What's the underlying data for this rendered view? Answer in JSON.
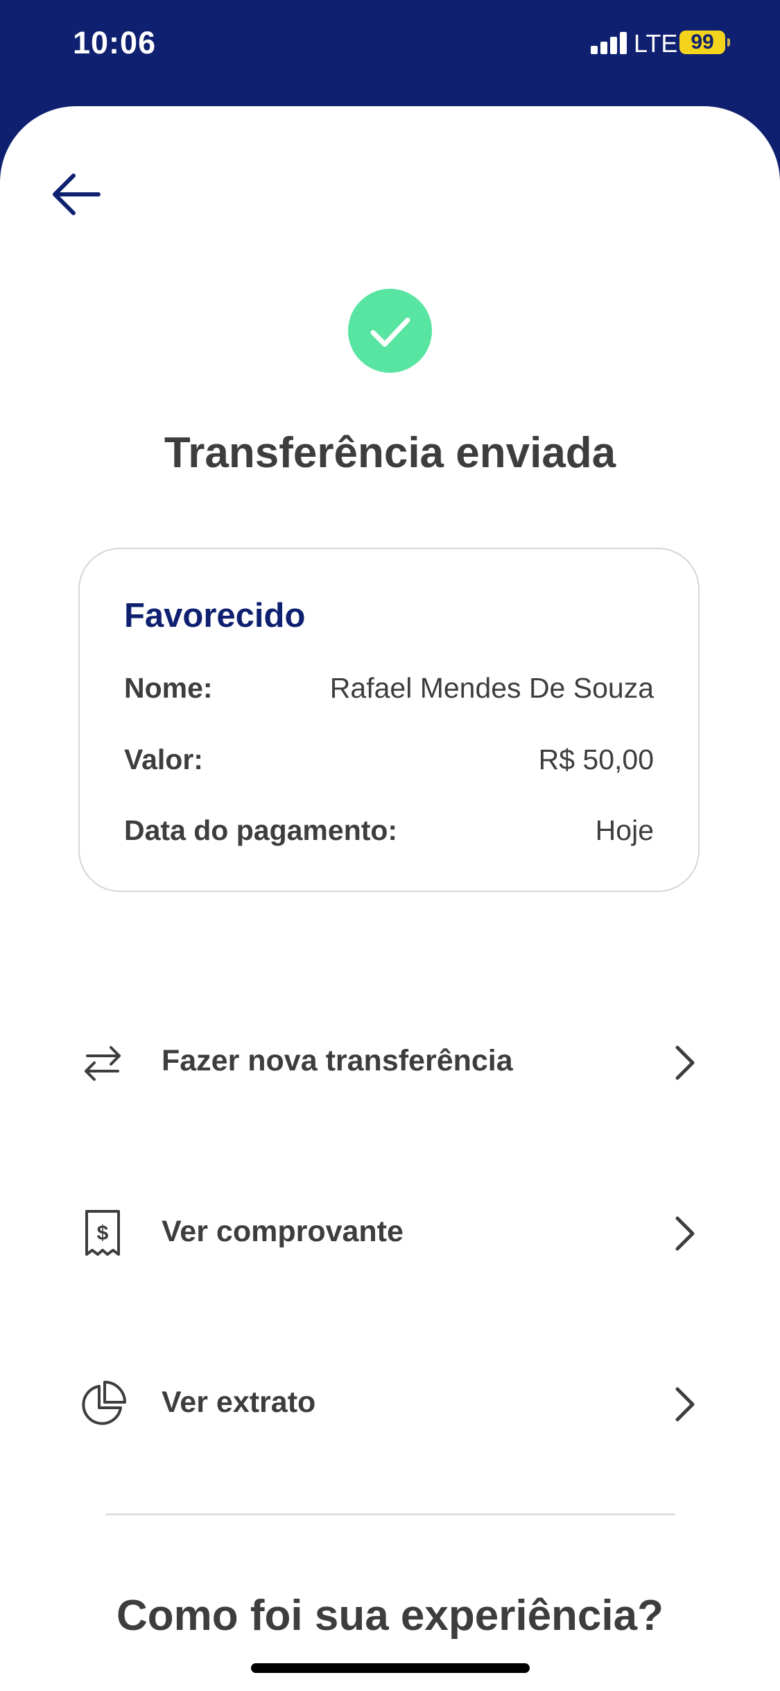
{
  "status_bar": {
    "time": "10:06",
    "network": "LTE",
    "battery": "99"
  },
  "confirmation": {
    "title": "Transferência enviada"
  },
  "beneficiary_card": {
    "title": "Favorecido",
    "rows": [
      {
        "label": "Nome:",
        "value": "Rafael Mendes De Souza"
      },
      {
        "label": "Valor:",
        "value": "R$ 50,00"
      },
      {
        "label": "Data do pagamento:",
        "value": "Hoje"
      }
    ]
  },
  "actions": [
    {
      "label": "Fazer nova transferência",
      "icon": "transfer-arrows-icon"
    },
    {
      "label": "Ver comprovante",
      "icon": "receipt-icon"
    },
    {
      "label": "Ver extrato",
      "icon": "pie-chart-icon"
    }
  ],
  "feedback": {
    "title": "Como foi sua experiência?"
  },
  "colors": {
    "brand_navy": "#0f2070",
    "success_green": "#58e4a1",
    "battery_yellow": "#f3d31c",
    "text_dark": "#3d3d3d"
  }
}
